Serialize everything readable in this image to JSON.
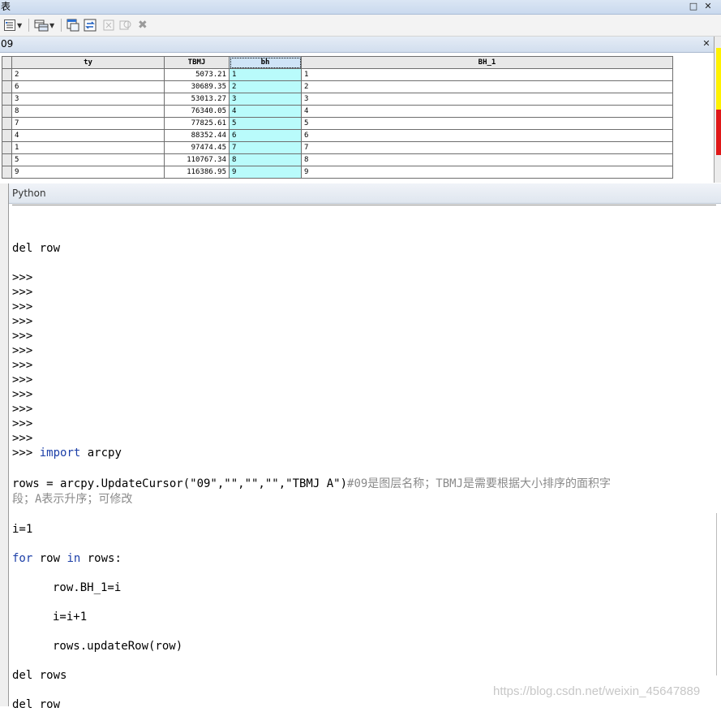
{
  "window": {
    "title": "表"
  },
  "layer": {
    "name": "09"
  },
  "table": {
    "headers": [
      "ty",
      "TBMJ",
      "bh",
      "BH_1"
    ],
    "rows": [
      [
        "2",
        "5073.21",
        "1",
        "1"
      ],
      [
        "6",
        "30689.35",
        "2",
        "2"
      ],
      [
        "3",
        "53013.27",
        "3",
        "3"
      ],
      [
        "8",
        "76340.05",
        "4",
        "4"
      ],
      [
        "7",
        "77825.61",
        "5",
        "5"
      ],
      [
        "4",
        "88352.44",
        "6",
        "6"
      ],
      [
        "1",
        "97474.45",
        "7",
        "7"
      ],
      [
        "5",
        "110767.34",
        "8",
        "8"
      ],
      [
        "9",
        "116386.95",
        "9",
        "9"
      ]
    ]
  },
  "python": {
    "title": "Python",
    "prompt": ">>>",
    "lines": {
      "del_row_top": "del row",
      "import_kw": "import",
      "import_mod": "arcpy",
      "rows_code": "rows = arcpy.UpdateCursor(\"09\",\"\",\"\",\"\",\"TBMJ A\")",
      "rows_comment_1": "#09是图层名称；TBMJ是需要根据大小排序的面积字",
      "rows_comment_2": "段；A表示升序；可修改",
      "i_init": "i=1",
      "for_1": "for",
      "for_2": " row ",
      "for_3": "in",
      "for_4": " rows:",
      "assign": "row.BH_1=i",
      "incr": "i=i+1",
      "update": "rows.updateRow(row)",
      "del_rows": "del rows",
      "del_row": "del row"
    }
  },
  "watermark": "https://blog.csdn.net/weixin_45647889",
  "icons": {
    "win_restore": "□",
    "win_close": "✕",
    "layer_close": "✕",
    "delete_icon": "✖"
  }
}
